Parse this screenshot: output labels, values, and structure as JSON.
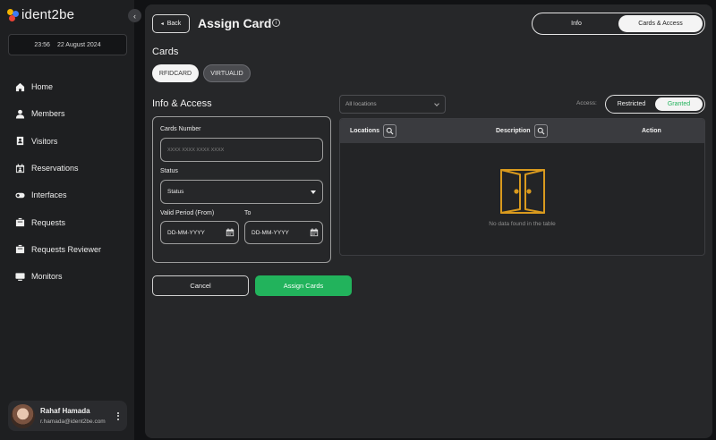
{
  "app": {
    "name": "ident2be",
    "brand_colors": [
      "#f4b400",
      "#3d7bf4",
      "#e94235"
    ]
  },
  "datetime": {
    "time": "23:56",
    "date": "22 August 2024"
  },
  "sidebar": {
    "collapse_icon": "chevron-left-icon",
    "items": [
      {
        "label": "Home",
        "icon": "home-icon"
      },
      {
        "label": "Members",
        "icon": "person-icon"
      },
      {
        "label": "Visitors",
        "icon": "badge-icon"
      },
      {
        "label": "Reservations",
        "icon": "calendar-person-icon"
      },
      {
        "label": "Interfaces",
        "icon": "toggle-icon"
      },
      {
        "label": "Requests",
        "icon": "inbox-icon"
      },
      {
        "label": "Requests Reviewer",
        "icon": "inbox-review-icon"
      },
      {
        "label": "Monitors",
        "icon": "monitor-icon"
      }
    ]
  },
  "user": {
    "name": "Rahaf Hamada",
    "email": "r.hamada@ident2be.com"
  },
  "header": {
    "back_label": "Back",
    "title": "Assign Card",
    "tabs": [
      {
        "label": "Info",
        "active": false
      },
      {
        "label": "Cards & Access",
        "active": true
      }
    ]
  },
  "cards": {
    "heading": "Cards",
    "types": [
      {
        "label": "RFIDCARD",
        "active": true
      },
      {
        "label": "VIRTUALID",
        "active": false
      }
    ]
  },
  "form": {
    "heading": "Info & Access",
    "cards_number_label": "Cards Number",
    "cards_number_placeholder": "XXXX XXXX XXXX XXXX",
    "status_label": "Status",
    "status_value": "Status",
    "valid_from_label": "Valid Period (From)",
    "valid_to_label": "To",
    "date_placeholder_from": "DD-MM-YYYY",
    "date_placeholder_to": "DD-MM-YYYY"
  },
  "actions": {
    "cancel_label": "Cancel",
    "assign_label": "Assign Cards",
    "assign_color": "#22b35c"
  },
  "filters": {
    "locations_value": "All locations",
    "access_label": "Access:",
    "access_options": [
      {
        "label": "Restricted",
        "active": false
      },
      {
        "label": "Granted",
        "active": true
      }
    ]
  },
  "table": {
    "columns": [
      {
        "label": "Locations",
        "searchable": true
      },
      {
        "label": "Description",
        "searchable": true
      },
      {
        "label": "Action",
        "searchable": false
      }
    ],
    "empty_text": "No data found in the table",
    "empty_icon": "open-door-icon",
    "empty_icon_color": "#d99a1e"
  }
}
